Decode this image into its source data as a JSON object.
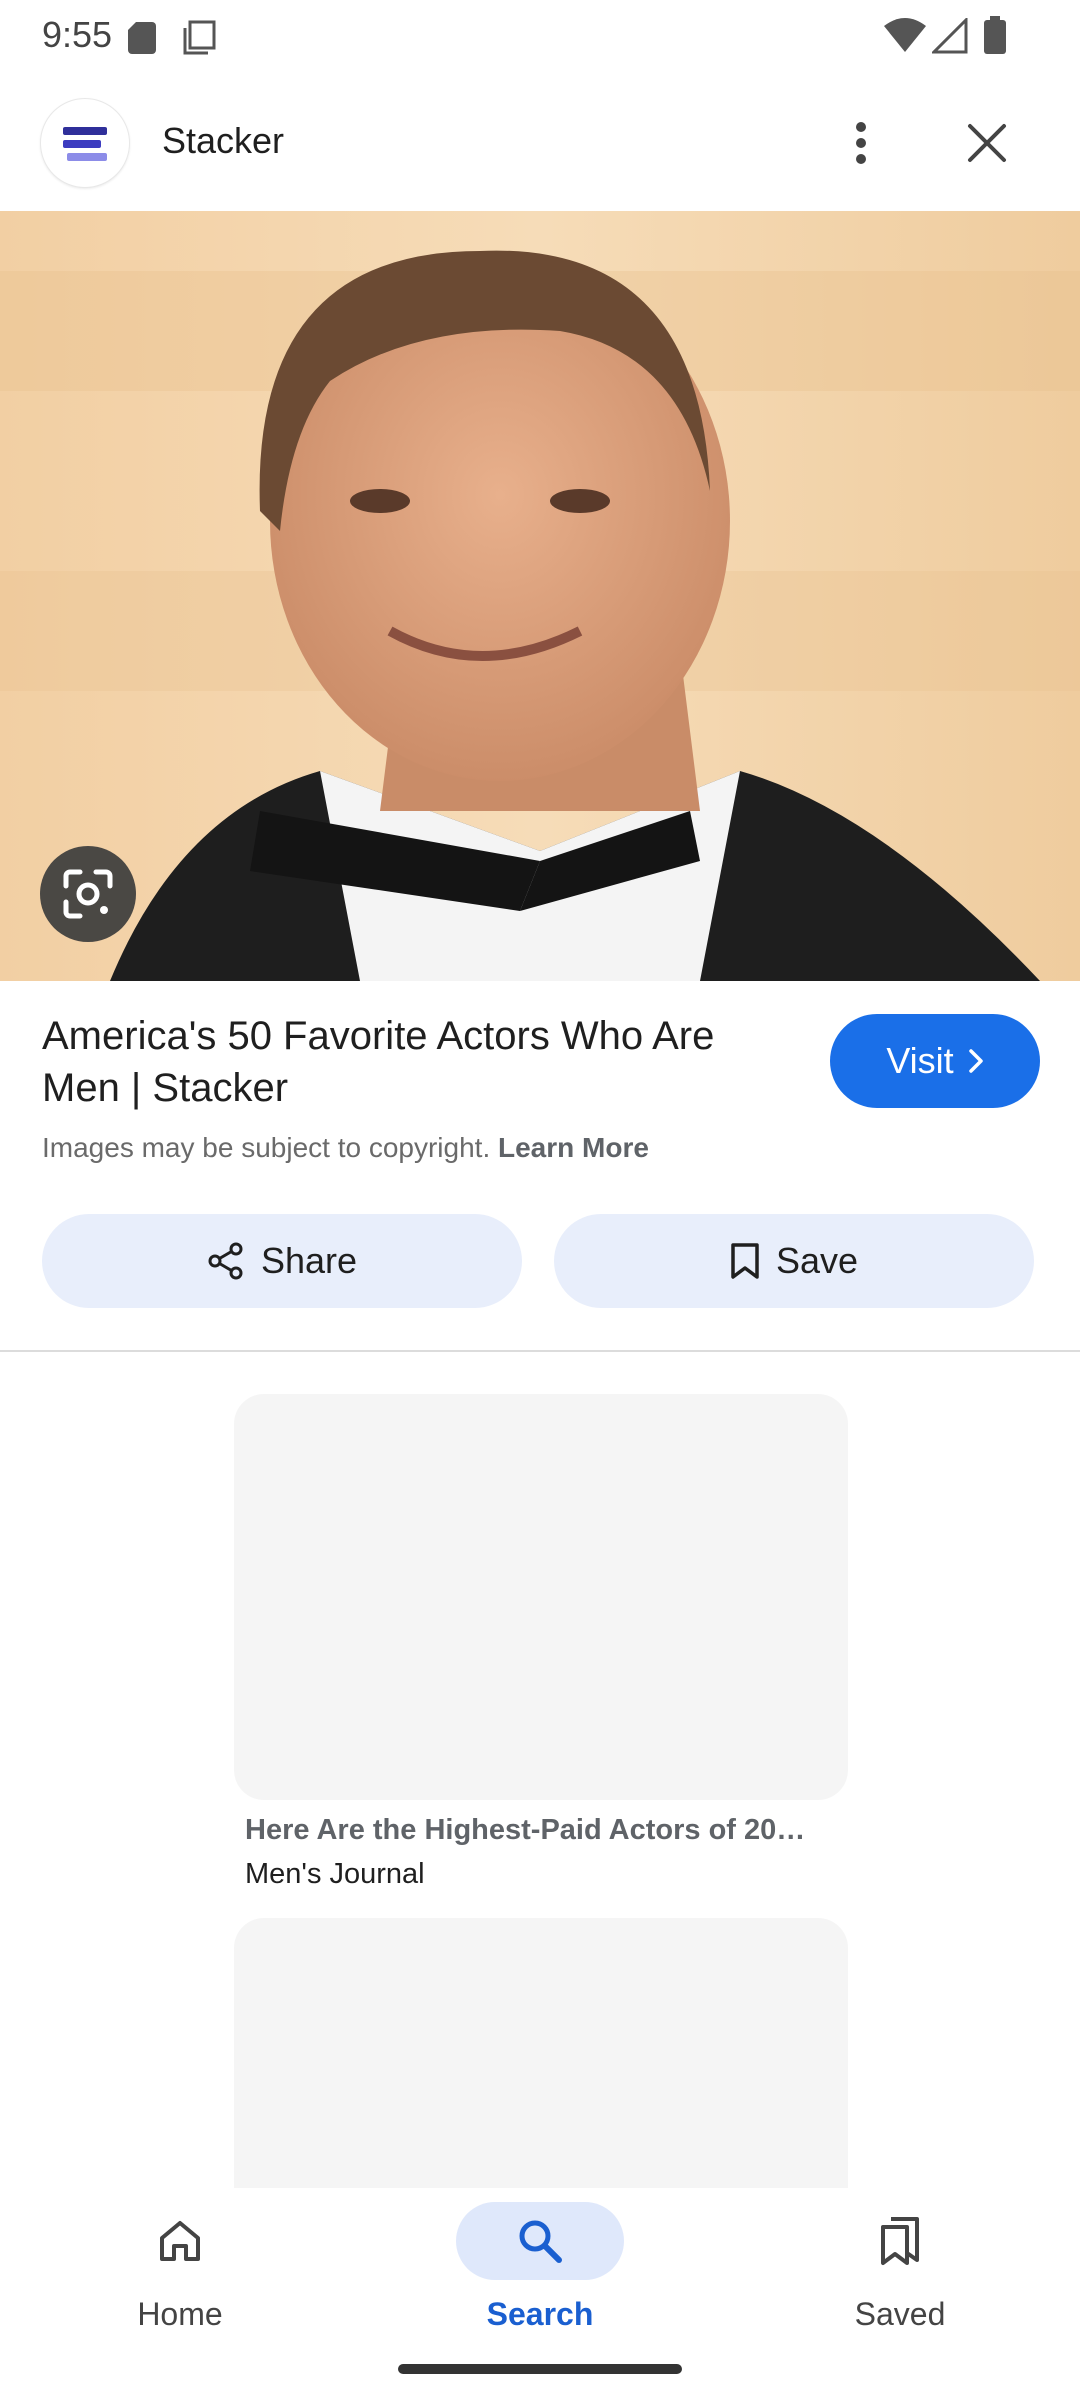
{
  "status_bar": {
    "time": "9:55",
    "icons": [
      "sd-card-icon",
      "copy-icon",
      "wifi-icon",
      "signal-icon",
      "battery-icon"
    ]
  },
  "header": {
    "site_name": "Stacker",
    "icons": [
      "stacker-logo-icon",
      "more-vert-icon",
      "close-icon"
    ]
  },
  "result": {
    "title": "America's 50 Favorite Actors Who Are Men | Stacker",
    "visit_label": "Visit",
    "copyright_text": "Images may be subject to copyright.",
    "learn_more": "Learn More",
    "share_label": "Share",
    "save_label": "Save"
  },
  "related": [
    {
      "title": "Here Are the Highest-Paid Actors of 20…",
      "source": "Men's Journal"
    }
  ],
  "bottom_nav": {
    "items": [
      {
        "label": "Home",
        "icon": "home-icon",
        "active": false
      },
      {
        "label": "Search",
        "icon": "search-icon",
        "active": true
      },
      {
        "label": "Saved",
        "icon": "saved-icon",
        "active": false
      }
    ]
  },
  "colors": {
    "accent": "#1a6fe8",
    "chip_bg": "#e8eefb",
    "nav_active_bg": "#dfe8fb"
  }
}
